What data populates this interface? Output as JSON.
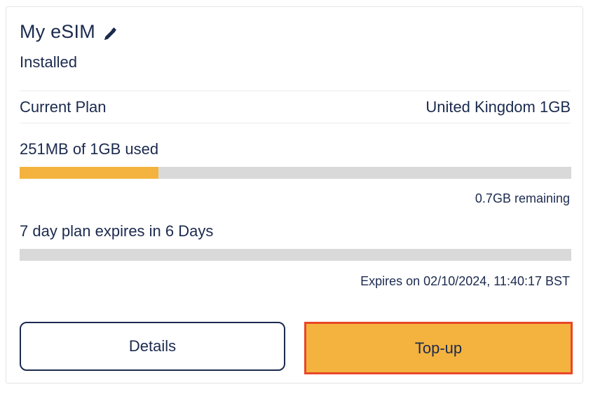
{
  "esim": {
    "title": "My eSIM",
    "status": "Installed"
  },
  "plan": {
    "label": "Current Plan",
    "value": "United Kingdom 1GB"
  },
  "usage": {
    "text": "251MB of 1GB used",
    "used_fraction": 0.251,
    "remaining": "0.7GB remaining"
  },
  "validity": {
    "text": "7 day plan expires in 6 Days",
    "elapsed_fraction": 0.0,
    "expires_on": "Expires on 02/10/2024, 11:40:17 BST"
  },
  "buttons": {
    "details": "Details",
    "topup": "Top-up"
  },
  "colors": {
    "text": "#1b2a4e",
    "accent": "#f4b33e",
    "track": "#d9d9d9",
    "highlight": "#e8472a"
  },
  "icons": {
    "edit": "pencil-icon"
  }
}
